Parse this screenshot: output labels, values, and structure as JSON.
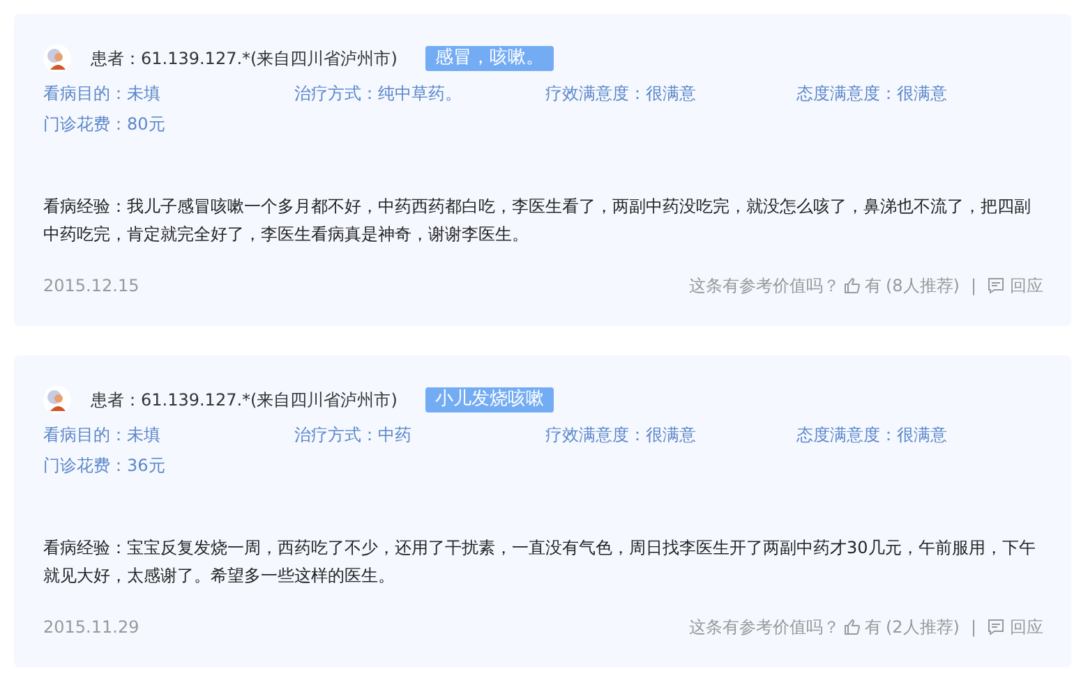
{
  "reviews": [
    {
      "patient": "患者：61.139.127.*(来自四川省泸州市)",
      "tag": "感冒，咳嗽。",
      "fields": [
        "看病目的：未填",
        "治疗方式：纯中草药。",
        "疗效满意度：很满意",
        "态度满意度：很满意",
        "门诊花费：80元"
      ],
      "experience": "看病经验：我儿子感冒咳嗽一个多月都不好，中药西药都白吃，李医生看了，两副中药没吃完，就没怎么咳了，鼻涕也不流了，把四副中药吃完，肯定就完全好了，李医生看病真是神奇，谢谢李医生。",
      "date": "2015.12.15",
      "question": "这条有参考价值吗？",
      "yes": "有",
      "count": "(8人推荐)",
      "separator": "|",
      "reply": "回应"
    },
    {
      "patient": "患者：61.139.127.*(来自四川省泸州市)",
      "tag": "小儿发烧咳嗽",
      "fields": [
        "看病目的：未填",
        "治疗方式：中药",
        "疗效满意度：很满意",
        "态度满意度：很满意",
        "门诊花费：36元"
      ],
      "experience": "看病经验：宝宝反复发烧一周，西药吃了不少，还用了干扰素，一直没有气色，周日找李医生开了两副中药才30几元，午前服用，下午就见大好，太感谢了。希望多一些这样的医生。",
      "date": "2015.11.29",
      "question": "这条有参考价值吗？",
      "yes": "有",
      "count": "(2人推荐)",
      "separator": "|",
      "reply": "回应"
    }
  ]
}
